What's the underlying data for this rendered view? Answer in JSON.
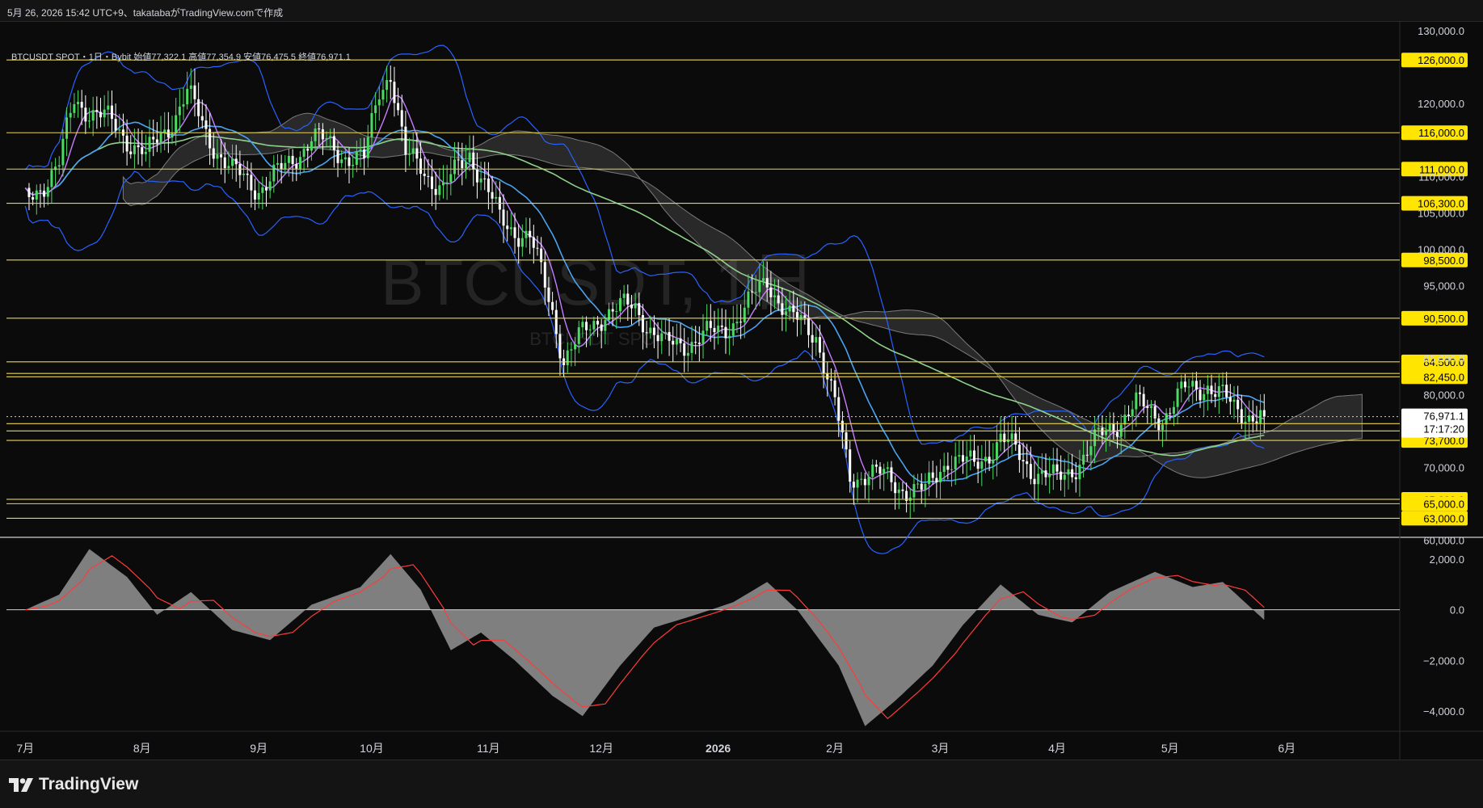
{
  "header_text": "5月 26, 2026 15:42 UTC+9、takatabaがTradingView.comで作成",
  "legend": {
    "symbol": "BTCUSDT SPOT・1日・Bybit",
    "open_label": "始値",
    "open": "77,322.1",
    "high_label": "高値",
    "high": "77,354.9",
    "low_label": "安値",
    "low": "76,475.5",
    "close_label": "終値",
    "close": "76,971.1"
  },
  "watermark": {
    "title": "BTCUSDT, 1日",
    "subtitle": "BTCUSDT SPOT"
  },
  "logo_text": "TradingView",
  "colors": {
    "background": "#0b0b0b",
    "up_candle": "#4cd964",
    "down_candle": "#ffffff",
    "level_line": "#e8d44d",
    "level_tag_bg": "#ffe500",
    "bollinger": "#2962ff",
    "ma_short": "#c77dff",
    "ma_mid": "#4aa3f0",
    "ma_long": "#8fd18a",
    "cloud": "#7a7a7a",
    "macd_signal": "#ff3b3b",
    "macd_hist": "#8c8c8c"
  },
  "chart_data": [
    {
      "type": "candlestick",
      "title": "BTCUSDT SPOT・1日・Bybit",
      "ylim": [
        60600,
        130800
      ],
      "y_ticks": [
        "130,000.0",
        "120,000.0",
        "110,000.0",
        "105,000.0",
        "100,000.0",
        "95,000.0",
        "80,000.0",
        "85,000.0",
        "75,000.0",
        "70,000.0",
        "60,000.0"
      ],
      "x_labels": [
        "7月",
        "8月",
        "9月",
        "10月",
        "11月",
        "12月",
        "2026",
        "2月",
        "3月",
        "4月",
        "5月",
        "6月"
      ],
      "horizontal_levels": [
        "126,000.0",
        "116,000.0",
        "111,000.0",
        "106,300.0",
        "98,500.0",
        "90,500.0",
        "84,500.0",
        "82,900.0",
        "82,450.0",
        "76,000.0",
        "75,000.0",
        "73,700.0",
        "65,600.0",
        "65,000.0",
        "63,000.0"
      ],
      "last_price": {
        "value": "76,971.1",
        "countdown": "17:17:20"
      },
      "close_path": [
        [
          "2025-07-01",
          106500
        ],
        [
          "2025-07-10",
          111500
        ],
        [
          "2025-07-14",
          120500
        ],
        [
          "2025-07-22",
          118000
        ],
        [
          "2025-08-01",
          113500
        ],
        [
          "2025-08-02",
          112500
        ],
        [
          "2025-08-08",
          117000
        ],
        [
          "2025-08-13",
          121500
        ],
        [
          "2025-08-18",
          116000
        ],
        [
          "2025-08-25",
          110500
        ],
        [
          "2025-09-01",
          108500
        ],
        [
          "2025-09-08",
          111000
        ],
        [
          "2025-09-15",
          115500
        ],
        [
          "2025-09-22",
          113500
        ],
        [
          "2025-09-29",
          112000
        ],
        [
          "2025-10-03",
          122000
        ],
        [
          "2025-10-06",
          124500
        ],
        [
          "2025-10-10",
          112500
        ],
        [
          "2025-10-14",
          111500
        ],
        [
          "2025-10-20",
          108000
        ],
        [
          "2025-10-27",
          113500
        ],
        [
          "2025-11-04",
          104000
        ],
        [
          "2025-11-12",
          101500
        ],
        [
          "2025-11-18",
          91500
        ],
        [
          "2025-11-21",
          85000
        ],
        [
          "2025-11-25",
          87500
        ],
        [
          "2025-12-02",
          91500
        ],
        [
          "2025-12-10",
          92000
        ],
        [
          "2025-12-18",
          86500
        ],
        [
          "2025-12-25",
          87500
        ],
        [
          "2026-01-01",
          88500
        ],
        [
          "2026-01-08",
          91500
        ],
        [
          "2026-01-14",
          96000
        ],
        [
          "2026-01-20",
          90500
        ],
        [
          "2026-01-27",
          88500
        ],
        [
          "2026-02-01",
          78500
        ],
        [
          "2026-02-05",
          68500
        ],
        [
          "2026-02-10",
          69500
        ],
        [
          "2026-02-18",
          67500
        ],
        [
          "2026-02-25",
          66500
        ],
        [
          "2026-03-03",
          71500
        ],
        [
          "2026-03-10",
          70000
        ],
        [
          "2026-03-17",
          74000
        ],
        [
          "2026-03-25",
          70000
        ],
        [
          "2026-04-01",
          68000
        ],
        [
          "2026-04-08",
          71500
        ],
        [
          "2026-04-15",
          75500
        ],
        [
          "2026-04-22",
          78500
        ],
        [
          "2026-04-29",
          77000
        ],
        [
          "2026-05-05",
          80500
        ],
        [
          "2026-05-11",
          81500
        ],
        [
          "2026-05-18",
          78000
        ],
        [
          "2026-05-26",
          76971
        ]
      ]
    },
    {
      "type": "area",
      "title": "MACD",
      "ylim": [
        -4800,
        2800
      ],
      "y_ticks": [
        "2,000.0",
        "0.0",
        "−2,000.0",
        "−4,000.0"
      ],
      "histogram_path": [
        [
          "2025-07-01",
          0
        ],
        [
          "2025-07-10",
          600
        ],
        [
          "2025-07-18",
          2400
        ],
        [
          "2025-07-28",
          1300
        ],
        [
          "2025-08-05",
          -200
        ],
        [
          "2025-08-14",
          700
        ],
        [
          "2025-08-25",
          -800
        ],
        [
          "2025-09-04",
          -1200
        ],
        [
          "2025-09-15",
          200
        ],
        [
          "2025-09-28",
          900
        ],
        [
          "2025-10-06",
          2200
        ],
        [
          "2025-10-14",
          800
        ],
        [
          "2025-10-22",
          -1600
        ],
        [
          "2025-10-30",
          -900
        ],
        [
          "2025-11-08",
          -2000
        ],
        [
          "2025-11-18",
          -3400
        ],
        [
          "2025-11-26",
          -4200
        ],
        [
          "2025-12-06",
          -2200
        ],
        [
          "2025-12-15",
          -700
        ],
        [
          "2025-12-26",
          -200
        ],
        [
          "2026-01-05",
          300
        ],
        [
          "2026-01-14",
          1100
        ],
        [
          "2026-01-22",
          0
        ],
        [
          "2026-02-02",
          -2200
        ],
        [
          "2026-02-09",
          -4600
        ],
        [
          "2026-02-17",
          -3600
        ],
        [
          "2026-02-27",
          -2200
        ],
        [
          "2026-03-07",
          -600
        ],
        [
          "2026-03-17",
          1000
        ],
        [
          "2026-03-27",
          -200
        ],
        [
          "2026-04-05",
          -500
        ],
        [
          "2026-04-15",
          700
        ],
        [
          "2026-04-27",
          1500
        ],
        [
          "2026-05-07",
          900
        ],
        [
          "2026-05-15",
          1100
        ],
        [
          "2026-05-26",
          -400
        ]
      ]
    }
  ]
}
